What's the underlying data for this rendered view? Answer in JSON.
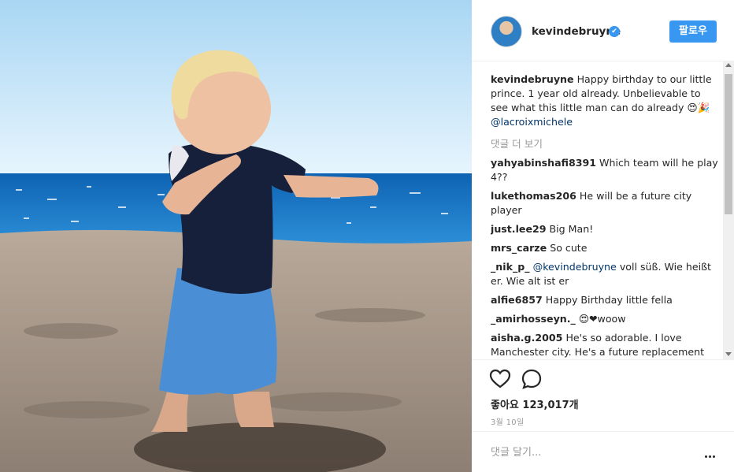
{
  "post": {
    "username": "kevindebruyne",
    "verified_icon": "✔",
    "follow_label": "팔로우",
    "caption_user": "kevindebruyne",
    "caption_text": "Happy birthday to our little prince. 1 year old already. Unbelievable to see what this little man can do already 😍🎉",
    "caption_mention": "@lacroixmichele",
    "load_more": "댓글 더 보기",
    "comments": [
      {
        "user": "yahyabinshafi8391",
        "text": "Which team will he play 4??"
      },
      {
        "user": "lukethomas206",
        "text": "He will be a future city player"
      },
      {
        "user": "just.lee29",
        "text": "Big Man!"
      },
      {
        "user": "mrs_carze",
        "text": "So cute"
      },
      {
        "user": "_nik_p_",
        "mention": "@kevindebruyne",
        "text": "voll süß. Wie heißt er. Wie alt ist er"
      },
      {
        "user": "alfie6857",
        "text": "Happy Birthday little fella"
      },
      {
        "user": "_amirhosseyn._",
        "text": "😍❤woow"
      },
      {
        "user": "aisha.g.2005",
        "text": "He's so adorable. I love Manchester city. He's a future replacement"
      }
    ],
    "likes_text": "좋아요 123,017개",
    "date": "3월 10일",
    "add_comment_placeholder": "댓글 달기...",
    "accent_color": "#3897f0"
  }
}
